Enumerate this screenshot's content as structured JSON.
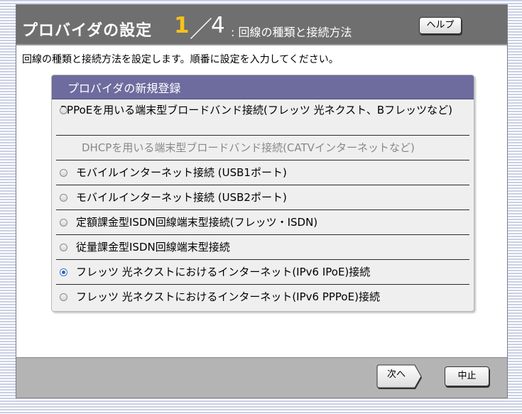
{
  "header": {
    "title": "プロバイダの設定",
    "step_current": "1",
    "step_slash": "／",
    "step_total": "4",
    "step_label": ": 回線の種類と接続方法",
    "help_label": "ヘルプ"
  },
  "instruction": "回線の種類と接続方法を設定します。順番に設定を入力してください。",
  "panel": {
    "title": "プロバイダの新規登録",
    "options": [
      {
        "label": "PPPoEを用いる端末型ブロードバンド接続(フレッツ 光ネクスト、Bフレッツなど)",
        "selected": false,
        "enabled": true
      },
      {
        "label": "DHCPを用いる端末型ブロードバンド接続(CATVインターネットなど)",
        "selected": false,
        "enabled": false
      },
      {
        "label": "モバイルインターネット接続 (USB1ポート)",
        "selected": false,
        "enabled": true
      },
      {
        "label": "モバイルインターネット接続 (USB2ポート)",
        "selected": false,
        "enabled": true
      },
      {
        "label": "定額課金型ISDN回線端末型接続(フレッツ・ISDN)",
        "selected": false,
        "enabled": true
      },
      {
        "label": "従量課金型ISDN回線端末型接続",
        "selected": false,
        "enabled": true
      },
      {
        "label": "フレッツ 光ネクストにおけるインターネット(IPv6 IPoE)接続",
        "selected": true,
        "enabled": true
      },
      {
        "label": "フレッツ 光ネクストにおけるインターネット(IPv6 PPPoE)接続",
        "selected": false,
        "enabled": true
      }
    ]
  },
  "footer": {
    "next_label": "次へ",
    "cancel_label": "中止"
  },
  "colors": {
    "header_bg": "#6f6f6f",
    "step_accent": "#f6c21b",
    "panel_title_bg": "#6e6b9e",
    "footer_bg": "#b4b4b4",
    "radio_selected": "#2a60c8"
  }
}
